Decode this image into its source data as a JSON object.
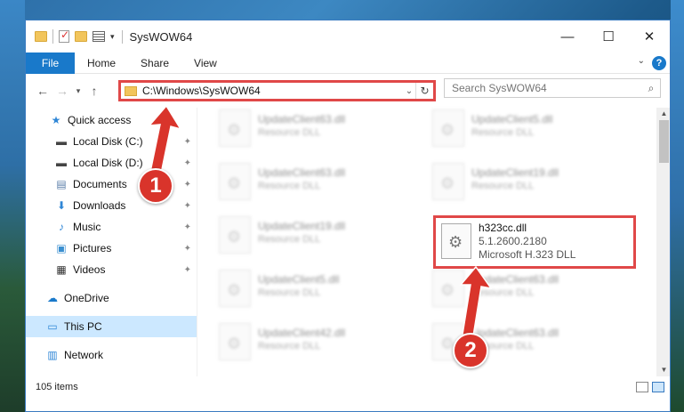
{
  "window": {
    "title": "SysWOW64",
    "accent": "#1979ca"
  },
  "ribbon": {
    "tabs": [
      "File",
      "Home",
      "Share",
      "View"
    ],
    "help": "?"
  },
  "address": {
    "path": "C:\\Windows\\SysWOW64",
    "search_placeholder": "Search SysWOW64"
  },
  "nav": {
    "items": [
      {
        "label": "Quick access",
        "icon": "star-icon"
      },
      {
        "label": "Local Disk (C:)",
        "icon": "drive-icon"
      },
      {
        "label": "Local Disk (D:)",
        "icon": "drive-icon"
      },
      {
        "label": "Documents",
        "icon": "documents-icon"
      },
      {
        "label": "Downloads",
        "icon": "download-icon"
      },
      {
        "label": "Music",
        "icon": "music-icon"
      },
      {
        "label": "Pictures",
        "icon": "pictures-icon"
      },
      {
        "label": "Videos",
        "icon": "videos-icon"
      },
      {
        "label": "OneDrive",
        "icon": "cloud-icon"
      },
      {
        "label": "This PC",
        "icon": "computer-icon"
      },
      {
        "label": "Network",
        "icon": "network-icon"
      }
    ]
  },
  "files": {
    "tiles": [
      {
        "name": "UpdateClient63.dll",
        "type": "Resource DLL"
      },
      {
        "name": "UpdateClient5.dll",
        "type": "Resource DLL"
      },
      {
        "name": "UpdateClient63.dll",
        "type": "Resource DLL"
      },
      {
        "name": "UpdateClient19.dll",
        "type": "Resource DLL"
      },
      {
        "name": "UpdateClient19.dll",
        "type": "Resource DLL"
      },
      {
        "name": "UpdateClient5.dll",
        "type": "Resource DLL"
      },
      {
        "name": "UpdateClient63.dll",
        "type": "Resource DLL"
      },
      {
        "name": "UpdateClient42.dll",
        "type": "Resource DLL"
      },
      {
        "name": "UpdateClient63.dll",
        "type": "Resource DLL"
      }
    ],
    "highlighted": {
      "name": "h323cc.dll",
      "version": "5.1.2600.2180",
      "description": "Microsoft H.323 DLL"
    }
  },
  "status": {
    "count": "105 items"
  },
  "annotations": {
    "step1": "1",
    "step2": "2",
    "color": "#d9342b"
  }
}
